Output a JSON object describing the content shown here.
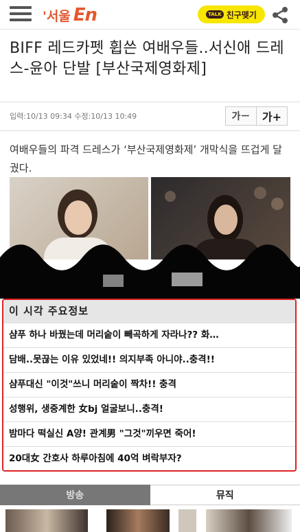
{
  "header": {
    "logo_kr": "'서울",
    "logo_en": "En",
    "kakao_badge": "TALK",
    "kakao_label": "친구맺기"
  },
  "article": {
    "headline": "BIFF 레드카펫 휩쓴 여배우들..서신애 드레스-윤아 단발 [부산국제영화제]",
    "meta": "입력:10/13 09:34  수정:10/13 10:49",
    "font_smaller": "가－",
    "font_larger": "가+",
    "summary": "여배우들의 파격 드레스가 ‘부산국제영화제’ 개막식을 뜨겁게 달궜다."
  },
  "popup": {
    "title": "이 시각 주요정보",
    "items": [
      "샴푸 하나 바꿨는데 머리숱이 빼곡하게 자라나?? 화…",
      "담배..못끊는 이유 있었네!! 의지부족 아니야..충격!!",
      "샴푸대신 \"이것\"쓰니 머리숱이 짝차!! 충격",
      "성행위, 생중계한 女bj 얼굴보니..충격!",
      "밤마다 떡실신 A양! 관계男 \"그것\"끼우면 죽어!",
      "20대女 간호사 하루아침에 40억 벼락부자?"
    ]
  },
  "tabs": {
    "broadcast": "방송",
    "music": "뮤직"
  }
}
